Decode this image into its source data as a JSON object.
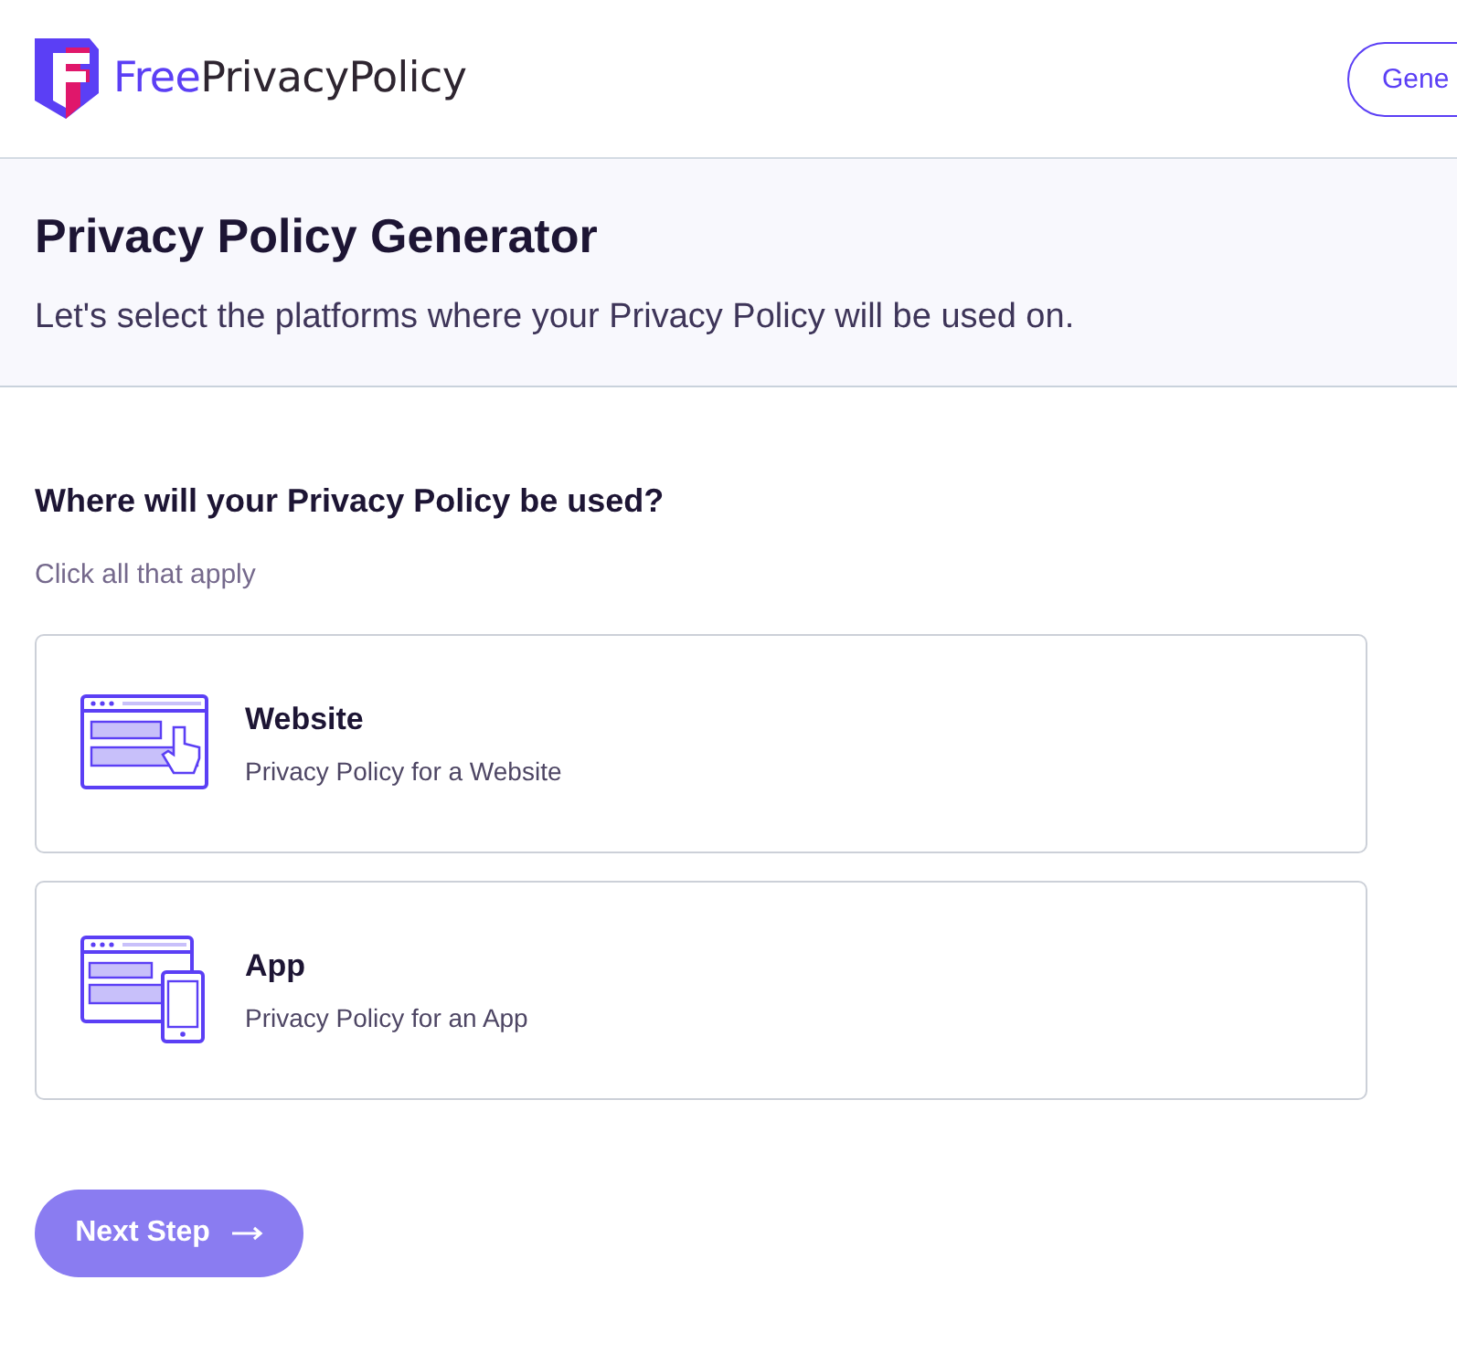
{
  "header": {
    "brand": {
      "first": "Free",
      "rest": "PrivacyPolicy"
    },
    "button": "Gene"
  },
  "intro": {
    "title": "Privacy Policy Generator",
    "subtitle": "Let's select the platforms where your Privacy Policy will be used on."
  },
  "question": {
    "title": "Where will your Privacy Policy be used?",
    "hint": "Click all that apply"
  },
  "platforms": [
    {
      "kind": "website",
      "title": "Website",
      "description": "Privacy Policy for a Website",
      "selected": false
    },
    {
      "kind": "app",
      "title": "App",
      "description": "Privacy Policy for an App",
      "selected": false
    }
  ],
  "next_button": {
    "label": "Next Step",
    "disabled": true
  }
}
